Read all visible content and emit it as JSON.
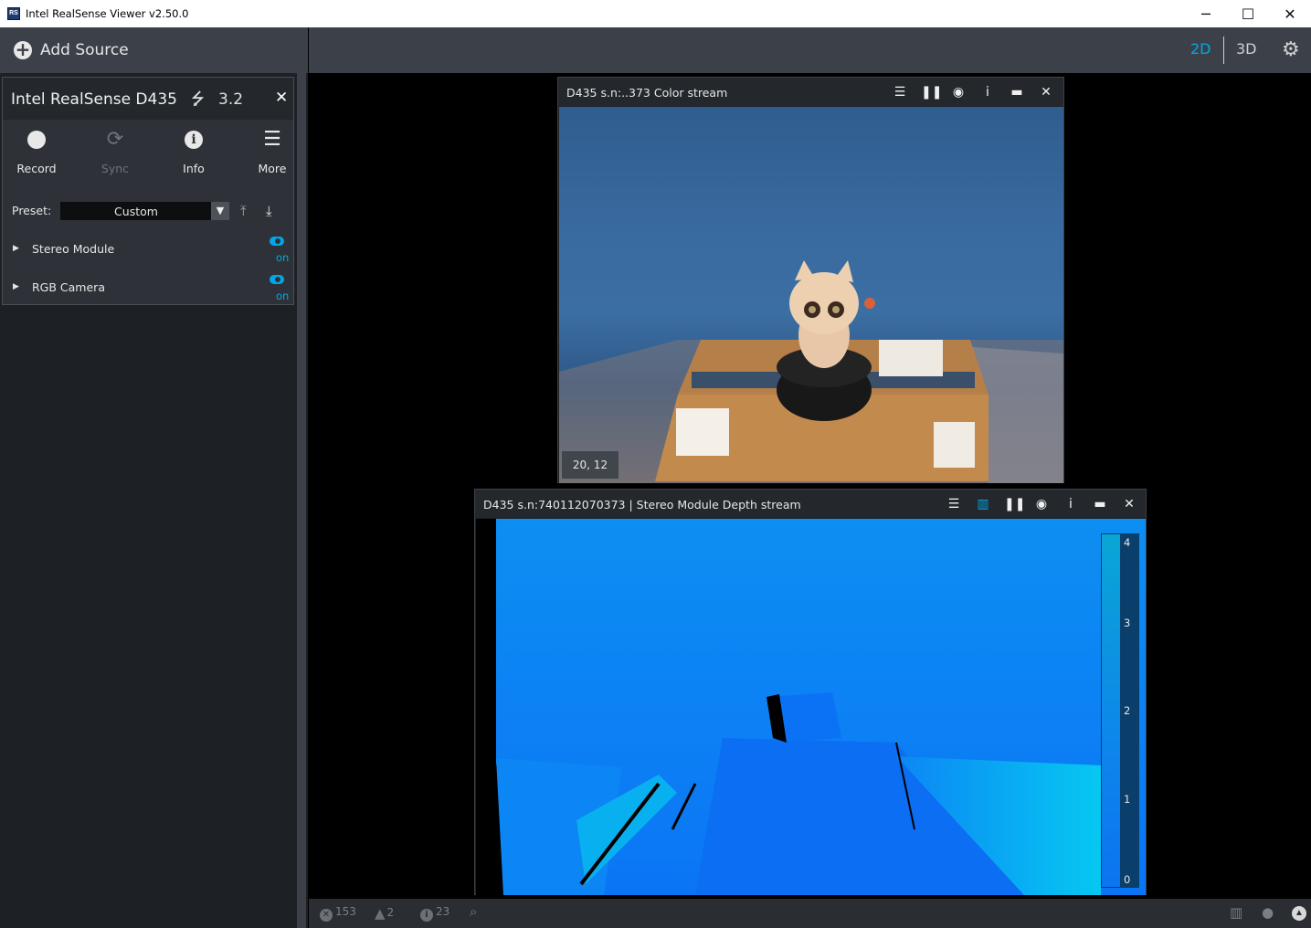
{
  "window": {
    "title": "Intel RealSense Viewer v2.50.0",
    "app_icon": "realsense-logo",
    "minimize": "─",
    "maximize": "☐",
    "close": "✕"
  },
  "toolbar": {
    "add_source_icon": "+",
    "add_source_label": "Add Source",
    "view_2d": "2D",
    "view_3d": "3D",
    "settings_icon": "⚙",
    "active_color": "#00a8e8"
  },
  "device": {
    "name": "Intel RealSense D435",
    "usb_icon": "⭍",
    "usb_version": "3.2",
    "close_icon": "✕",
    "actions": [
      {
        "label": "Record",
        "icon": "record-circle",
        "enabled": true
      },
      {
        "label": "Sync",
        "icon": "⟳",
        "enabled": false
      },
      {
        "label": "Info",
        "icon": "i",
        "enabled": true
      },
      {
        "label": "More",
        "icon": "☰",
        "enabled": true
      }
    ],
    "preset_label": "Preset:",
    "preset_value": "Custom",
    "preset_arrow": "▼",
    "upload_icon": "⤒",
    "download_icon": "⤓",
    "modules": [
      {
        "name": "Stereo Module",
        "expander": "▶",
        "state": "on"
      },
      {
        "name": "RGB Camera",
        "expander": "▶",
        "state": "on"
      }
    ]
  },
  "color_stream": {
    "title": "D435 s.n:..373 Color stream",
    "buttons": [
      "☰",
      "❚❚",
      "◉",
      "i",
      "▬",
      "✕"
    ],
    "coord_readout": "20, 12"
  },
  "depth_stream": {
    "title": "D435 s.n:740112070373 | Stereo Module Depth stream",
    "buttons": [
      "☰",
      "▥",
      "❚❚",
      "◉",
      "i",
      "▬",
      "✕"
    ],
    "colorbar_ticks": [
      "4",
      "3",
      "2",
      "1",
      "0"
    ]
  },
  "status": {
    "errors": "153",
    "warnings": "2",
    "infos": "23",
    "search_icon": "⌕",
    "error_icon": "✕",
    "warning_icon": "▲",
    "info_icon": "i",
    "right_icons": [
      "▥",
      "●",
      "▲"
    ]
  }
}
